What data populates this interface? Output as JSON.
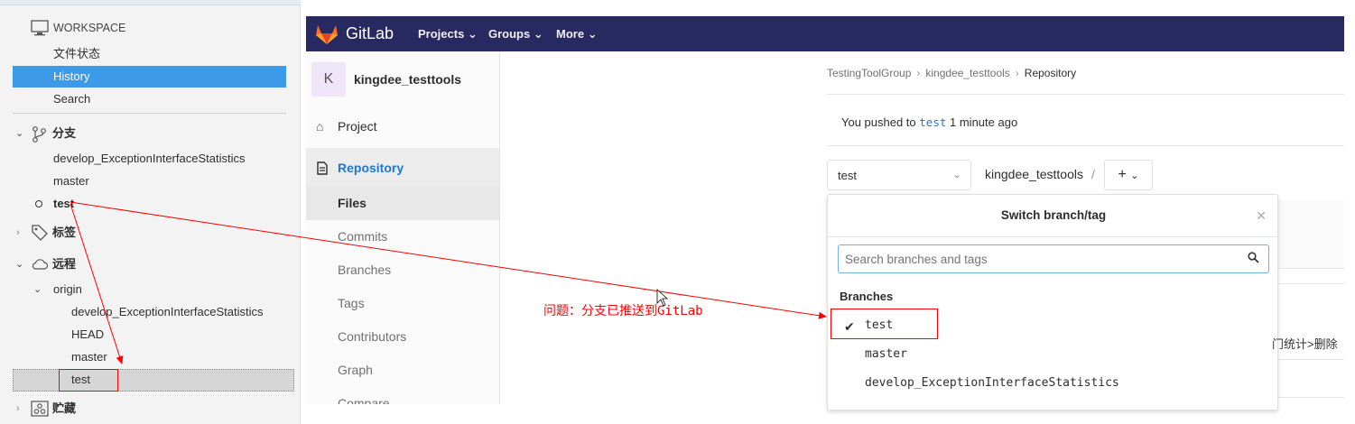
{
  "sourcetree": {
    "workspace": {
      "label": "WORKSPACE",
      "items": [
        "文件状态",
        "History",
        "Search"
      ],
      "selected": "History"
    },
    "branches": {
      "label": "分支",
      "items": [
        "develop_ExceptionInterfaceStatistics",
        "master",
        "test"
      ],
      "current": "test"
    },
    "tags": {
      "label": "标签"
    },
    "remotes": {
      "label": "远程",
      "origin": "origin",
      "items": [
        "develop_ExceptionInterfaceStatistics",
        "HEAD",
        "master",
        "test"
      ]
    },
    "stashes": {
      "label": "贮藏"
    }
  },
  "gitlab": {
    "brand": "GitLab",
    "nav": [
      "Projects",
      "Groups",
      "More"
    ],
    "project": {
      "avatar": "K",
      "name": "kingdee_testtools"
    },
    "sidebar": {
      "project": "Project",
      "repository": "Repository",
      "sub": [
        "Files",
        "Commits",
        "Branches",
        "Tags",
        "Contributors",
        "Graph",
        "Compare"
      ]
    },
    "breadcrumb": [
      "TestingToolGroup",
      "kingdee_testtools",
      "Repository"
    ],
    "push_msg": {
      "prefix": "You pushed to",
      "branch": "test",
      "suffix": "1 minute ago"
    },
    "branch_selector": "test",
    "repo_name": "kingdee_testtools",
    "dropdown": {
      "title": "Switch branch/tag",
      "search_placeholder": "Search branches and tags",
      "section": "Branches",
      "branches": [
        "test",
        "master",
        "develop_ExceptionInterfaceStatistics"
      ],
      "selected": "test"
    },
    "right_peek": "门统计>删除"
  },
  "annotation": {
    "note": "问题：分支已推送到GitLab",
    "color": "#ff0000"
  }
}
